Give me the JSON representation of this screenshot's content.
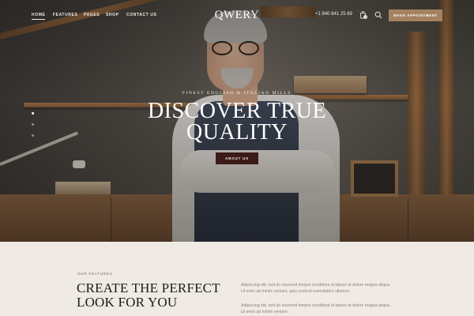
{
  "nav": {
    "items": [
      {
        "label": "Home",
        "active": true
      },
      {
        "label": "Features",
        "active": false
      },
      {
        "label": "Pages",
        "active": false
      },
      {
        "label": "Shop",
        "active": false
      },
      {
        "label": "Contact us",
        "active": false
      }
    ],
    "logo": "QWERY",
    "phone": "+1 840 841 25 69",
    "cta_label": "Make appointment",
    "icons": [
      "cart-icon",
      "search-icon"
    ]
  },
  "hero": {
    "subtitle": "Finest English & Italian Mills",
    "title_line1": "Discover True",
    "title_line2": "Quality",
    "button_label": "About us",
    "slider_dots": 3,
    "active_dot": 1
  },
  "features": {
    "eyebrow": "Our features",
    "title_line1": "Create the perfect",
    "title_line2": "look for you",
    "paragraph1_line1": "Adipiscing elit, sed do eiusmod tempor incididunt ut labore et dolore magna aliqua.",
    "paragraph1_line2": "Ut enim ad minim veniam, quis nostrud exercitation ullamco.",
    "paragraph2_line1": "Adipiscing elit, sed do eiusmod tempor incididunt ut labore et dolore magna aliqua.",
    "paragraph2_line2": "Ut enim ad minim veniam."
  },
  "colors": {
    "accent": "#a5825f",
    "button_dark": "#3b1a17",
    "background": "#efeae3"
  }
}
